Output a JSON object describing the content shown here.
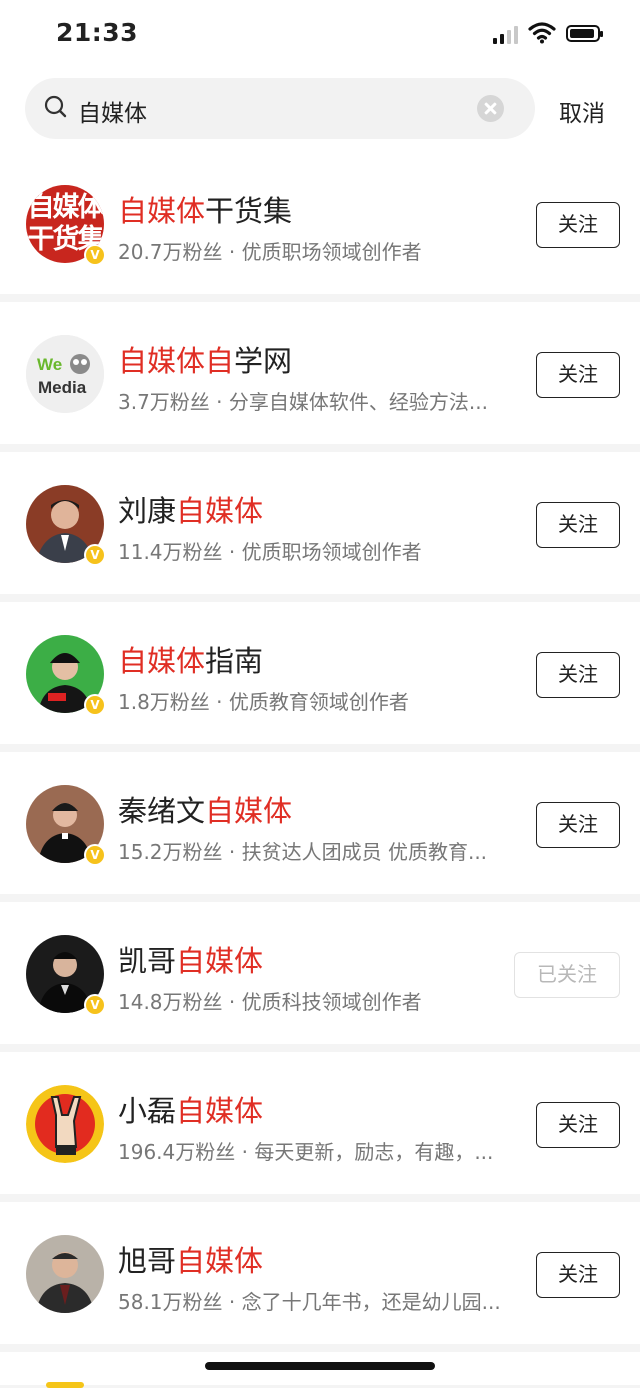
{
  "status_bar": {
    "time": "21:33"
  },
  "search": {
    "query": "自媒体",
    "cancel_label": "取消"
  },
  "results": [
    {
      "name_pre": "",
      "name_hl": "自媒体",
      "name_post": "干货集",
      "desc": "20.7万粉丝 · 优质职场领域创作者",
      "button": "关注",
      "followed": false,
      "verified": true,
      "avatar_text": "自媒体干货集"
    },
    {
      "name_pre": "",
      "name_hl": "自媒体自",
      "name_post": "学网",
      "desc": "3.7万粉丝 · 分享自媒体软件、经验方法...",
      "button": "关注",
      "followed": false,
      "verified": false,
      "avatar_text": "We Media"
    },
    {
      "name_pre": "刘康",
      "name_hl": "自媒体",
      "name_post": "",
      "desc": "11.4万粉丝 · 优质职场领域创作者",
      "button": "关注",
      "followed": false,
      "verified": true
    },
    {
      "name_pre": "",
      "name_hl": "自媒体",
      "name_post": "指南",
      "desc": "1.8万粉丝 · 优质教育领域创作者",
      "button": "关注",
      "followed": false,
      "verified": true
    },
    {
      "name_pre": "秦绪文",
      "name_hl": "自媒体",
      "name_post": "",
      "desc": "15.2万粉丝 · 扶贫达人团成员 优质教育...",
      "button": "关注",
      "followed": false,
      "verified": true
    },
    {
      "name_pre": "凯哥",
      "name_hl": "自媒体",
      "name_post": "",
      "desc": "14.8万粉丝 · 优质科技领域创作者",
      "button": "已关注",
      "followed": true,
      "verified": true
    },
    {
      "name_pre": "小磊",
      "name_hl": "自媒体",
      "name_post": "",
      "desc": "196.4万粉丝 · 每天更新，励志，有趣，...",
      "button": "关注",
      "followed": false,
      "verified": false
    },
    {
      "name_pre": "旭哥",
      "name_hl": "自媒体",
      "name_post": "",
      "desc": "58.1万粉丝 · 念了十几年书，还是幼儿园...",
      "button": "关注",
      "followed": false,
      "verified": false
    }
  ],
  "colors": {
    "highlight": "#e02e24",
    "badge": "#f6c21c"
  }
}
